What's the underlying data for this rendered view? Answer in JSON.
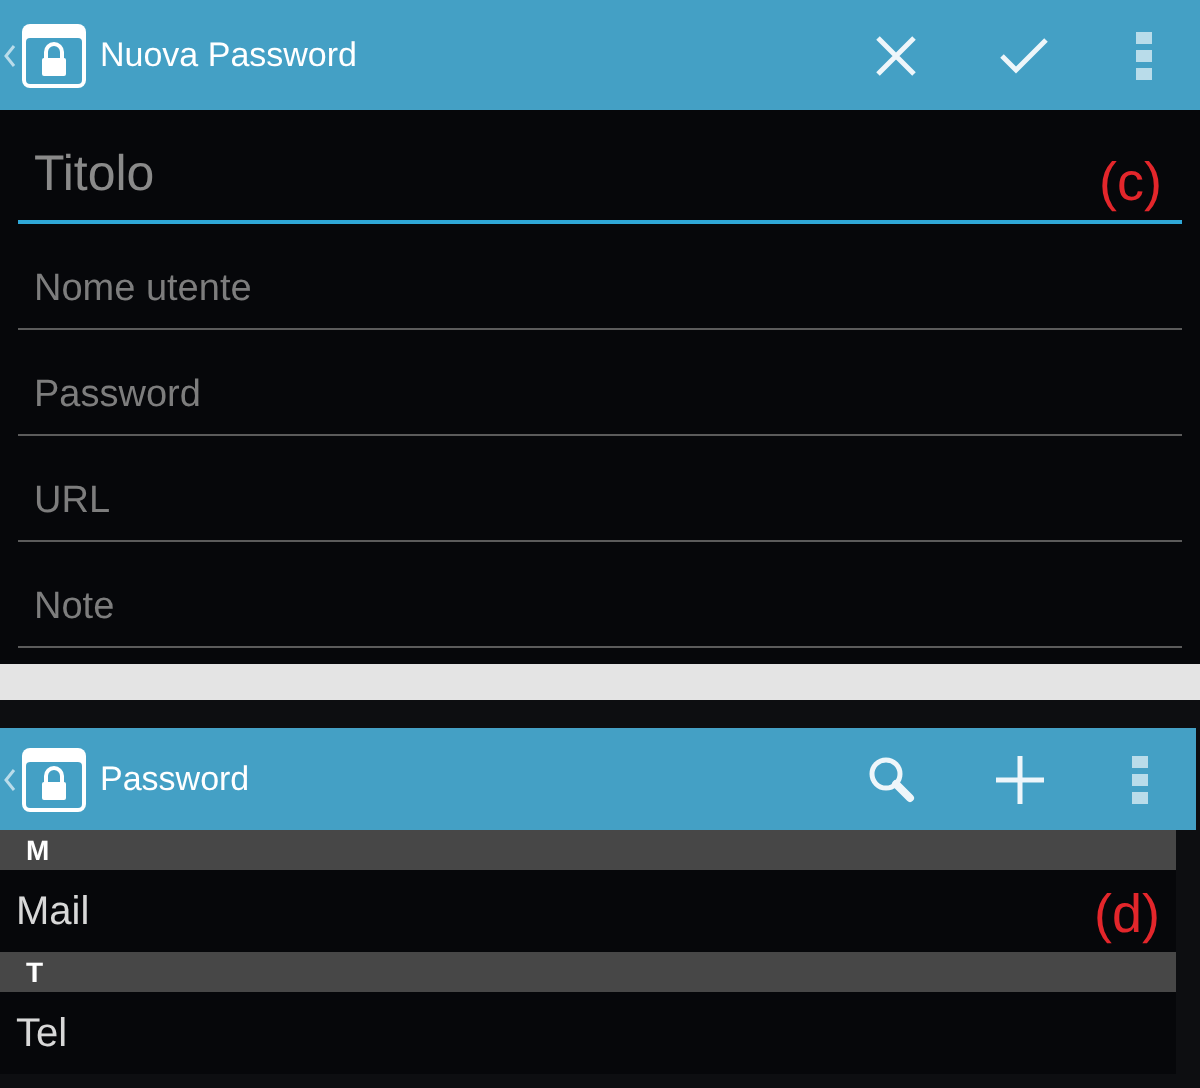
{
  "edit_screen": {
    "action_bar": {
      "title": "Nuova Password",
      "actions": [
        {
          "kind": "close"
        },
        {
          "kind": "check"
        },
        {
          "kind": "overflow"
        }
      ]
    },
    "fields": [
      {
        "placeholder": "Titolo",
        "focused": true
      },
      {
        "placeholder": "Nome utente",
        "focused": false
      },
      {
        "placeholder": "Password",
        "focused": false
      },
      {
        "placeholder": "URL",
        "focused": false
      },
      {
        "placeholder": "Note",
        "focused": false
      }
    ],
    "annotation": "(c)"
  },
  "list_screen": {
    "action_bar": {
      "title": "Password",
      "actions": [
        {
          "kind": "search"
        },
        {
          "kind": "add"
        },
        {
          "kind": "overflow"
        }
      ]
    },
    "sections": [
      {
        "header": "M",
        "items": [
          "Mail"
        ]
      },
      {
        "header": "T",
        "items": [
          "Tel"
        ]
      }
    ],
    "annotation": "(d)"
  }
}
